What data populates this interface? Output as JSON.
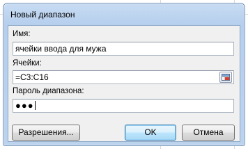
{
  "dialog": {
    "title": "Новый диапазон",
    "name_label": "Имя:",
    "name_value": "ячейки ввода для мужа",
    "cells_label": "Ячейки:",
    "cells_value": "=C3:C16",
    "password_label": "Пароль диапазона:",
    "password_value": "●●●",
    "permissions_button": "Разрешения...",
    "ok_button": "OK",
    "cancel_button": "Отмена"
  }
}
